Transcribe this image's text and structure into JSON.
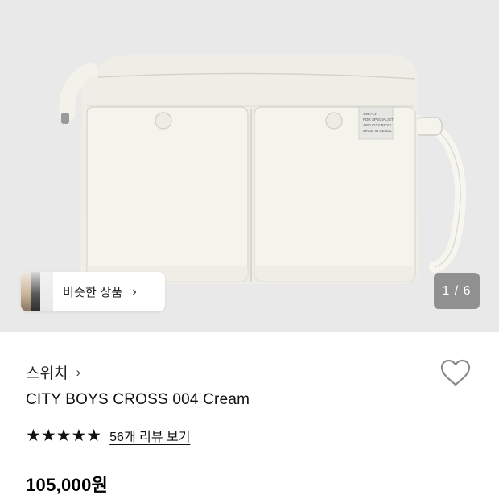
{
  "hero": {
    "image_alt": "cream crossbody bag",
    "similar_products_label": "비슷한 상품",
    "chevron_glyph": "›",
    "counter_text": "1 / 6",
    "tag_lines": [
      "SWITCH",
      "FOR SPECIALIST",
      "AND CITY BOYS",
      "MADE IN SEOUL"
    ]
  },
  "product": {
    "brand": "스위치",
    "brand_chevron": "›",
    "title": "CITY BOYS CROSS 004 Cream",
    "rating": {
      "stars": "★★★★★",
      "value_out_of_5": 5,
      "review_link": "56개 리뷰 보기"
    },
    "price": "105,000원"
  },
  "icons": {
    "wishlist": "heart-outline-icon",
    "chevron": "chevron-right-icon"
  },
  "colors": {
    "hero_background": "#e9e9e9",
    "bag_cream": "#f3f2ea",
    "counter_bg": "#6e6e6e"
  }
}
